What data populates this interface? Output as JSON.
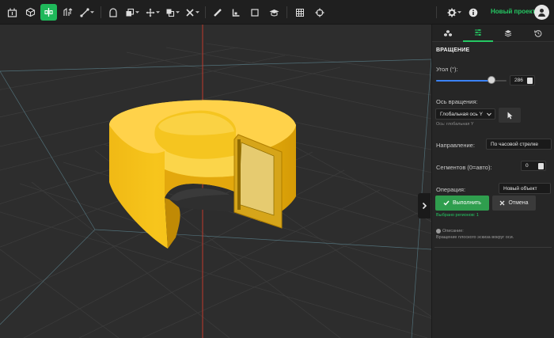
{
  "toolbar": {
    "project_name": "Новый проект",
    "accent_color": "#1fb85a"
  },
  "panel": {
    "tabs": [
      {
        "icon": "cubes-icon"
      },
      {
        "icon": "sliders-icon",
        "active": true
      },
      {
        "icon": "layers-icon"
      },
      {
        "icon": "history-icon"
      }
    ],
    "section_title": "ВРАЩЕНИЕ",
    "angle": {
      "label": "Угол (°):",
      "value": "286",
      "fraction": 0.79
    },
    "axis": {
      "label": "Ось вращения:",
      "selected": "Глобальная ось Y",
      "hint": "Ось: глобальная Y"
    },
    "direction": {
      "label": "Направление:",
      "selected": "По часовой стрелке"
    },
    "segments": {
      "label": "Сегментов (0=авто):",
      "value": "0"
    },
    "operation": {
      "label": "Операция:",
      "selected": "Новый объект"
    },
    "run_label": "Выполнить",
    "cancel_label": "Отмена",
    "selected_regions": "Выбрано регионов: 1",
    "description_label": "Описание:",
    "description_text": "Вращение плоского эскиза вокруг оси."
  }
}
